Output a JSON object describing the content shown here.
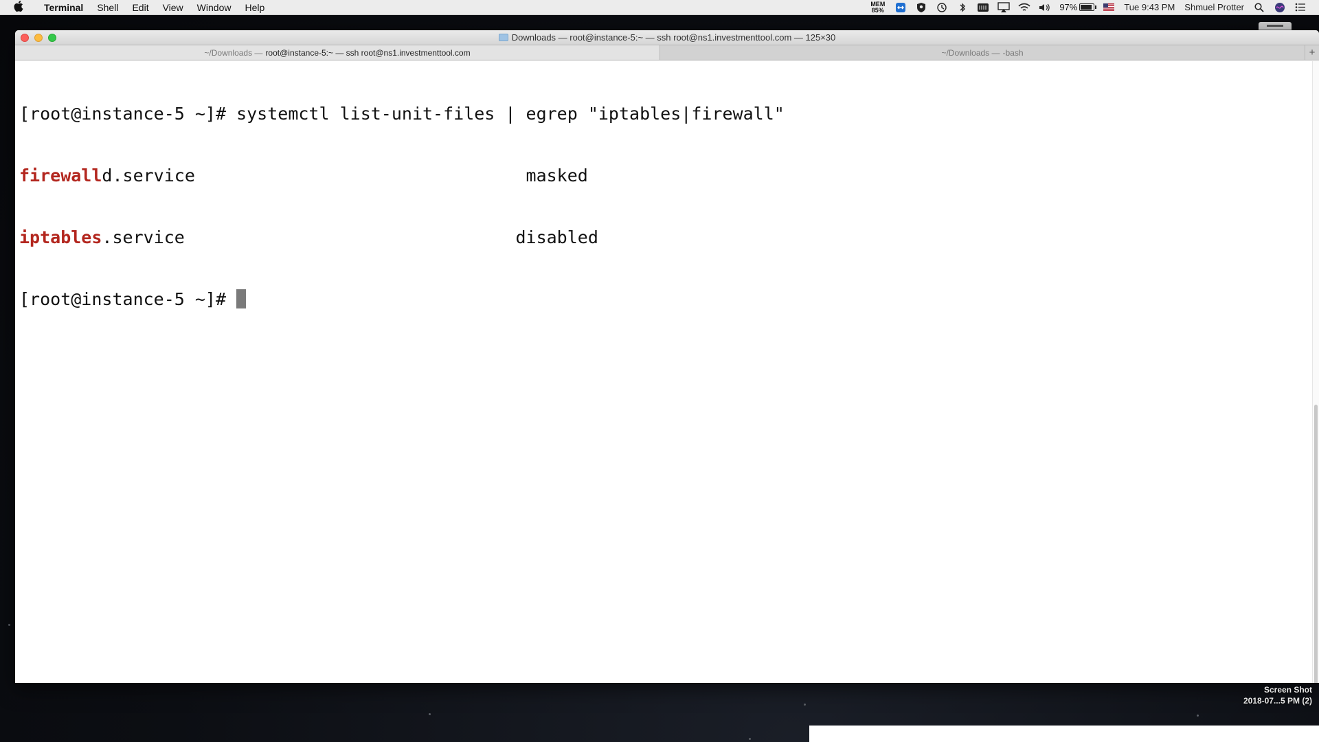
{
  "menubar": {
    "app_name": "Terminal",
    "items": [
      "Shell",
      "Edit",
      "View",
      "Window",
      "Help"
    ],
    "mem_label": "MEM",
    "mem_value": "85%",
    "battery_percent": "97%",
    "clock": "Tue 9:43 PM",
    "user": "Shmuel Protter",
    "icons": [
      "apple-icon",
      "teamviewer-icon",
      "shield-icon",
      "time-machine-icon",
      "bluetooth-icon",
      "keyboard-icon",
      "airplay-icon",
      "wifi-icon",
      "volume-icon",
      "battery-icon",
      "us-flag-icon",
      "search-icon",
      "siri-icon",
      "notification-list-icon"
    ]
  },
  "window": {
    "title": "Downloads — root@instance-5:~ — ssh root@ns1.investmenttool.com — 125×30",
    "tabs": [
      {
        "dim": "~/Downloads —",
        "label": "root@instance-5:~ — ssh root@ns1.investmenttool.com",
        "active": true
      },
      {
        "dim": "~/Downloads —",
        "label": "-bash",
        "active": false
      }
    ],
    "add_tab": "+"
  },
  "terminal": {
    "line1": "[root@instance-5 ~]# systemctl list-unit-files | egrep \"iptables|firewall\"",
    "line2_match": "firewall",
    "line2_rest": "d.service                                masked",
    "line3_match": "iptables",
    "line3_rest": ".service                                disabled",
    "line4_prompt": "[root@instance-5 ~]# "
  },
  "desktop": {
    "screenshot_label_line1": "Screen Shot",
    "screenshot_label_line2": "2018-07...5 PM (2)"
  }
}
